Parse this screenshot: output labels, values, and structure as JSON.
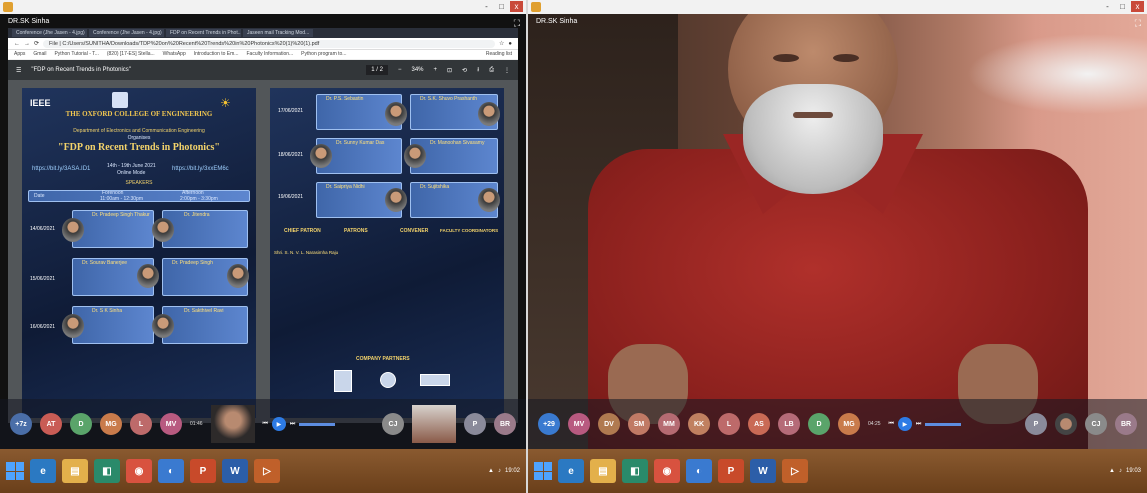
{
  "left": {
    "window_controls": [
      "-",
      "□",
      "x"
    ],
    "name_tag": "DR.SK Sinha",
    "browser": {
      "tabs": [
        "Conference (Jhe Jasen - 4.jpg)",
        "Conference (Jhe Jasen - 4.jpg)",
        "FDP on Recent Trends in Phot...",
        "Jaseen mail Tracking Mod..."
      ],
      "url": "File | C:/Users/SUNITHA/Downloads/TDP%20on%20Recent%20Trends%20in%20Photonics%20(1)%20(1).pdf",
      "bookmarks": [
        "Apps",
        "Gmail",
        "Python Tutorial - T...",
        "(820) [17-ES] Stella...",
        "WhatsApp",
        "Introduction to Em...",
        "Faculty Information...",
        "Python program to..."
      ],
      "reading_list": "Reading list",
      "pdf_title": "\"FDP on Recent Trends in Photonics\"",
      "page_counter": "1 / 2",
      "zoom": "34%",
      "page1": {
        "ieee": "IEEE",
        "college": "THE OXFORD COLLEGE OF ENGINEERING",
        "dept": "Department of Electronics and Communication Engineering",
        "organizes": "Organises",
        "fdp_title": "\"FDP on Recent Trends in Photonics\"",
        "dates": "14th - 19th June 2021",
        "mode": "Online Mode",
        "link_left": "https://bit.ly/3ASA.ID1",
        "link_right": "https://bit.ly/3xxEM6c",
        "speakers_label": "SPEAKERS",
        "session_left": "Forenoon",
        "session_left_time": "11:00am - 12:30pm",
        "session_right": "Afternoon",
        "session_right_time": "2:00pm - 3:30pm",
        "date_label": "Date",
        "rows": [
          "14/06/2021",
          "15/06/2021",
          "16/06/2021"
        ],
        "speakers": [
          "Dr. Pradeep Singh Thakur",
          "Dr. Jitendra",
          "Dr. Sourav Banerjee",
          "Dr. Pradeep Singh",
          "Dr. S K Sinha",
          "Dr. Sakthivel Ravi"
        ]
      },
      "page2": {
        "rows": [
          "17/06/2021",
          "18/06/2021",
          "19/06/2021"
        ],
        "speakers": [
          "Dr. P.S. Sebastin",
          "Dr. S.K. Shuvo Prashanth",
          "Dr. Sunny Kumar Das",
          "Dr. Manoohan Sivasamy",
          "Dr. Saipriya Nidhi",
          "Dr. Sujitshika"
        ],
        "chief_patron": "CHIEF PATRON",
        "patrons": "PATRONS",
        "convener": "CONVENER",
        "faculty_coordinators": "FACULTY COORDINATORS",
        "cp_name": "Shri. S. N. V. L. Narasimha Raju",
        "company_partners": "COMPANY PARTNERS"
      }
    },
    "participants": [
      {
        "label": "+7z",
        "color": "#4a6ea8"
      },
      {
        "label": "AT",
        "color": "#c95c55"
      },
      {
        "label": "D",
        "color": "#5aa46a"
      },
      {
        "label": "MG",
        "color": "#c97b4b"
      },
      {
        "label": "L",
        "color": "#bd6a6a"
      },
      {
        "label": "MV",
        "color": "#b85a80"
      }
    ],
    "right_participants": [
      {
        "label": "CJ",
        "color": "#8a8a8a"
      },
      {
        "label": "P",
        "color": "#8a8a9a"
      },
      {
        "label": "BR",
        "color": "#9a7a8a"
      }
    ],
    "time": "01:46"
  },
  "right": {
    "window_controls": [
      "-",
      "□",
      "x"
    ],
    "name_tag": "DR.SK Sinha",
    "participants": [
      {
        "label": "+29",
        "color": "#3a7ad0"
      },
      {
        "label": "MV",
        "color": "#b85a80"
      },
      {
        "label": "DV",
        "color": "#b07a50"
      },
      {
        "label": "SM",
        "color": "#c07a65"
      },
      {
        "label": "MM",
        "color": "#b56b72"
      },
      {
        "label": "KK",
        "color": "#c08060"
      },
      {
        "label": "L",
        "color": "#bd6a6a"
      },
      {
        "label": "AS",
        "color": "#c96a55"
      },
      {
        "label": "LB",
        "color": "#b56b78"
      },
      {
        "label": "D",
        "color": "#5aa46a"
      },
      {
        "label": "MG",
        "color": "#c97b4b"
      }
    ],
    "right_participants": [
      {
        "label": "P",
        "color": "#8a8a9a"
      },
      {
        "label": "CJ",
        "color": "#8a8a8a"
      },
      {
        "label": "BR",
        "color": "#9a7a8a"
      }
    ],
    "time": "04:25"
  },
  "taskbar": {
    "left_clock": "19:02",
    "right_clock": "19:03",
    "icons": [
      "ie-icon",
      "folder-icon",
      "store-icon",
      "chrome-icon",
      "edge-icon",
      "powerpoint-icon",
      "word-icon",
      "media-icon"
    ]
  }
}
